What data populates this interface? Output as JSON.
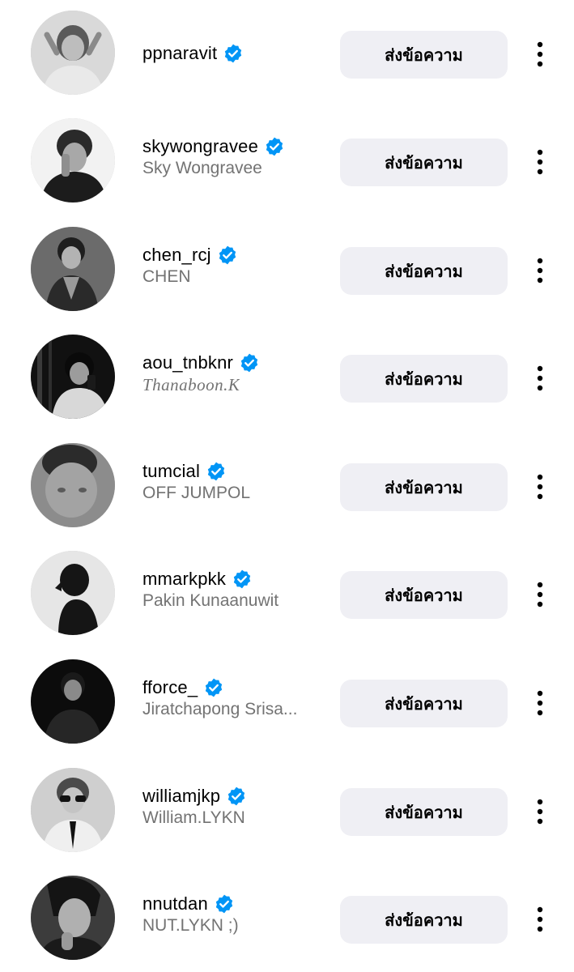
{
  "list": {
    "items": [
      {
        "username": "ppnaravit",
        "full_name": "",
        "button_label": "ส่งข้อความ",
        "verified": true
      },
      {
        "username": "skywongravee",
        "full_name": "Sky Wongravee",
        "button_label": "ส่งข้อความ",
        "verified": true
      },
      {
        "username": "chen_rcj",
        "full_name": "CHEN",
        "button_label": "ส่งข้อความ",
        "verified": true
      },
      {
        "username": "aou_tnbknr",
        "full_name": "Thanaboon.K",
        "button_label": "ส่งข้อความ",
        "verified": true
      },
      {
        "username": "tumcial",
        "full_name": "OFF JUMPOL",
        "button_label": "ส่งข้อความ",
        "verified": true
      },
      {
        "username": "mmarkpkk",
        "full_name": "Pakin Kunaanuwit",
        "button_label": "ส่งข้อความ",
        "verified": true
      },
      {
        "username": "fforce_",
        "full_name": "Jiratchapong Srisa...",
        "button_label": "ส่งข้อความ",
        "verified": true
      },
      {
        "username": "williamjkp",
        "full_name": "William.LYKN",
        "button_label": "ส่งข้อความ",
        "verified": true
      },
      {
        "username": "nnutdan",
        "full_name": "NUT.LYKN ;)",
        "button_label": "ส่งข้อความ",
        "verified": true
      }
    ]
  },
  "colors": {
    "verified_badge": "#0095f6",
    "button_background": "#efeff4",
    "secondary_text": "#737373",
    "primary_text": "#000000"
  },
  "icons": {
    "verified": "verified-badge-icon",
    "more": "more-vertical-icon",
    "avatar": "profile-photo"
  }
}
